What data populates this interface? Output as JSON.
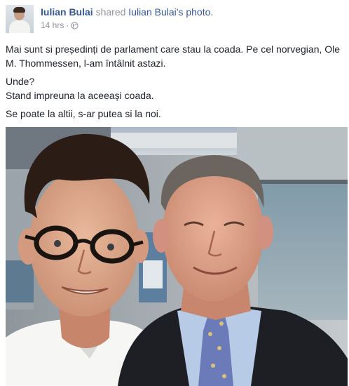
{
  "post": {
    "author": "Iulian Bulai",
    "shared_label": "shared",
    "photo_owner": "Iulian Bulai",
    "photo_suffix": "'s",
    "photo_word": "photo.",
    "timestamp": "14 hrs",
    "separator": "·",
    "privacy_icon": "globe-icon",
    "paragraphs": [
      "Mai sunt si președinți de parlament care stau la coada. Pe cel norvegian, Ole M. Thommessen, l-am întâlnit astazi.",
      "Unde?",
      "Stand impreuna la aceeași coada.",
      "Se poate la altii, s-ar putea si la noi."
    ]
  },
  "colors": {
    "link": "#365899",
    "secondary": "#90949c",
    "text": "#1d2129"
  }
}
